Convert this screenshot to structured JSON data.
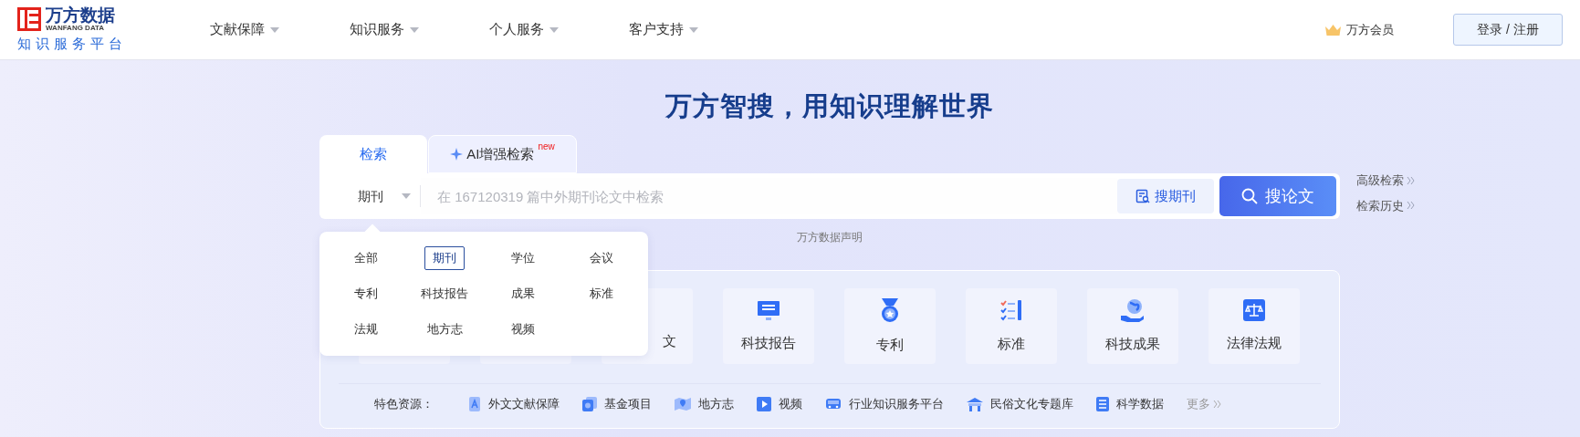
{
  "logo": {
    "name": "万方数据",
    "latin": "WANFANG DATA",
    "tagline": "知识服务平台"
  },
  "nav": [
    {
      "label": "文献保障"
    },
    {
      "label": "知识服务"
    },
    {
      "label": "个人服务"
    },
    {
      "label": "客户支持"
    }
  ],
  "member": "万方会员",
  "login": "登录 / 注册",
  "headline": "万方智搜，用知识理解世界",
  "tabs": [
    {
      "label": "检索",
      "selected": true
    },
    {
      "label": "AI增强检索",
      "selected": false,
      "badge": "new"
    }
  ],
  "search": {
    "scope": "期刊",
    "placeholder": "在 167120319 篇中外期刊论文中检索",
    "secondary": "搜期刊",
    "primary": "搜论文"
  },
  "side_links": [
    "高级检索",
    "检索历史"
  ],
  "notice": "万方数据声明",
  "dropdown": [
    {
      "label": "全部",
      "selected": false
    },
    {
      "label": "期刊",
      "selected": true
    },
    {
      "label": "学位",
      "selected": false
    },
    {
      "label": "会议",
      "selected": false
    },
    {
      "label": "专利",
      "selected": false
    },
    {
      "label": "科技报告",
      "selected": false
    },
    {
      "label": "成果",
      "selected": false
    },
    {
      "label": "标准",
      "selected": false
    },
    {
      "label": "法规",
      "selected": false
    },
    {
      "label": "地方志",
      "selected": false
    },
    {
      "label": "视频",
      "selected": false
    }
  ],
  "cards": [
    {
      "kind": "hidden"
    },
    {
      "kind": "hidden"
    },
    {
      "kind": "partial",
      "label": "文"
    },
    {
      "kind": "report",
      "label": "科技报告"
    },
    {
      "kind": "patent",
      "label": "专利"
    },
    {
      "kind": "standard",
      "label": "标准"
    },
    {
      "kind": "achievement",
      "label": "科技成果"
    },
    {
      "kind": "law",
      "label": "法律法规"
    }
  ],
  "features": {
    "label": "特色资源：",
    "items": [
      {
        "kind": "foreign",
        "label": "外文文献保障"
      },
      {
        "kind": "fund",
        "label": "基金项目"
      },
      {
        "kind": "map",
        "label": "地方志"
      },
      {
        "kind": "video",
        "label": "视频"
      },
      {
        "kind": "industry",
        "label": "行业知识服务平台"
      },
      {
        "kind": "folk",
        "label": "民俗文化专题库"
      },
      {
        "kind": "science",
        "label": "科学数据"
      }
    ],
    "more": "更多"
  }
}
